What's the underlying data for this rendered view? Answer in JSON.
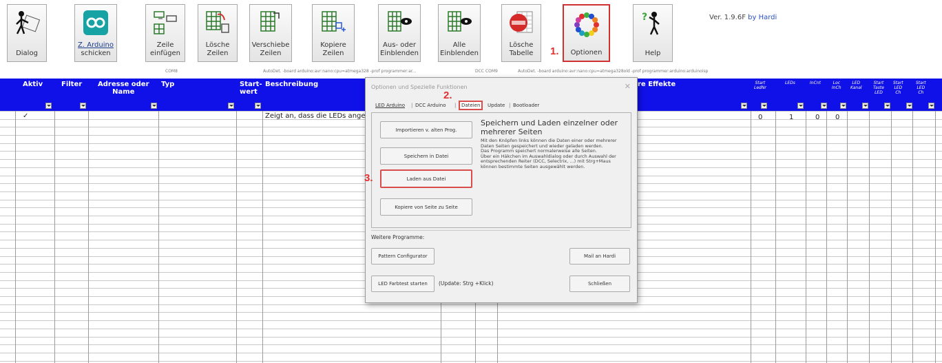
{
  "toolbar": {
    "dialog": {
      "label": "Dialog"
    },
    "arduino": {
      "line1": "Z. Arduino",
      "line2": "schicken"
    },
    "insert_row": {
      "line1": "Zeile",
      "line2": "einfügen"
    },
    "delete_rows": {
      "line1": "Lösche",
      "line2": "Zeilen"
    },
    "move_rows": {
      "line1": "Verschiebe",
      "line2": "Zeilen"
    },
    "copy_rows": {
      "line1": "Kopiere",
      "line2": "Zeilen"
    },
    "hide_show": {
      "line1": "Aus- oder",
      "line2": "Einblenden"
    },
    "show_all": {
      "line1": "Alle",
      "line2": "Einblenden"
    },
    "delete_table": {
      "line1": "Lösche",
      "line2": "Tabelle"
    },
    "options": {
      "label": "Optionen"
    },
    "help": {
      "label": "Help"
    }
  },
  "version": {
    "text": "Ver. 1.9.6F",
    "author": "by Hardi"
  },
  "steps": {
    "one": "1.",
    "two": "2.",
    "three": "3."
  },
  "tiny_labels": {
    "com": "COM8",
    "autodet1": "AutoDet. -board arduino:avr:nano:cpu=atmega328 -prof programmer:ar...",
    "dcc": "DCC COM9",
    "autodet2": "AutoDet. -board arduino:avr:nano:cpu=atmega328old -prof programmer:arduino:arduinoisp"
  },
  "columns": {
    "aktiv": "Aktiv",
    "filter": "Filter",
    "adresse": "Adresse oder\nName",
    "typ": "Typ",
    "start": "Start-\nwert",
    "beschreibung": "Beschreibung",
    "effekte": "re Effekte",
    "small": [
      "Start\nLedNr",
      "LEDs",
      "InCnt",
      "Loc\nInCh",
      "LED\nKanal",
      "Start\nTaste\nLED",
      "Start\nLED\nCh",
      "Start\nLED\nCh"
    ]
  },
  "row1": {
    "check": "✓",
    "desc": "Zeigt an, dass die LEDs ange",
    "v1": "0",
    "v2": "1",
    "v3": "0",
    "v4": "0"
  },
  "dialog": {
    "title": "Optionen und Spezielle Funktionen",
    "close": "✕",
    "tabs": [
      "LED Arduino",
      "DCC Arduino",
      "Dateien",
      "Update",
      "Bootloader"
    ],
    "buttons": {
      "import": "Importieren v. alten Prog.",
      "save": "Speichern in Datei",
      "load": "Laden aus Datei",
      "copy": "Kopiere von Seite zu Seite"
    },
    "panel_title": "Speichern und Laden einzelner oder mehrerer Seiten",
    "panel_desc": "Mit den Knöpfen links können die Daten einer oder mehrerer Daten Seiten gespeichert und wieder geladen werden.\nDas Programm speichert normalerweise alle Seiten.\nÜber ein Häkchen im Auswahldialog oder durch Auswahl der entsprechenden Reiter (DCC, Selectrix, ...) mit Strg+Maus können bestimmte Seiten ausgewählt werden.",
    "more_label": "Weitere Programme:",
    "pattern": "Pattern Configurator",
    "mail": "Mail an Hardi",
    "led_farbtest": "LED Farbtest starten",
    "update_hint": "(Update: Strg +Klick)",
    "close_btn": "Schließen"
  },
  "colors": {
    "header": "#1010e8",
    "highlight": "#d03030"
  }
}
